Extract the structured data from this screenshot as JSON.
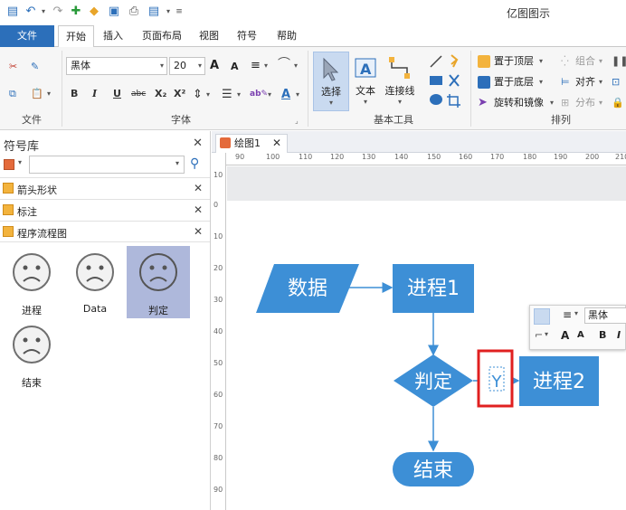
{
  "app": {
    "title": "亿图图示"
  },
  "tabs": [
    "文件",
    "开始",
    "插入",
    "页面布局",
    "视图",
    "符号",
    "帮助"
  ],
  "active_tab": "开始",
  "ribbon": {
    "font_group_label": "字体",
    "file_group_label": "文件",
    "basic_tools_label": "基本工具",
    "arrange_label": "排列",
    "font_name": "黑体",
    "font_size": "20",
    "select_label": "选择",
    "text_label": "文本",
    "connector_label": "连接线",
    "bring_front": "置于顶层",
    "send_back": "置于底层",
    "rotate_mirror": "旋转和镜像",
    "group": "组合",
    "align": "对齐",
    "distribute": "分布",
    "fmt_bold": "B",
    "fmt_italic": "I",
    "fmt_underline": "U",
    "fmt_strike": "abc",
    "fmt_sub": "X₂",
    "fmt_sup": "X²",
    "font_grow": "A",
    "font_shrink": "A",
    "font_color": "A"
  },
  "library": {
    "title": "符号库",
    "search_placeholder": "",
    "categories": [
      "箭头形状",
      "标注",
      "程序流程图"
    ],
    "symbols": [
      {
        "label": "进程",
        "selected": false
      },
      {
        "label": "Data",
        "selected": false
      },
      {
        "label": "判定",
        "selected": true
      },
      {
        "label": "结束",
        "selected": false
      }
    ]
  },
  "document": {
    "tab_name": "绘图1",
    "ruler_h": [
      "90",
      "100",
      "110",
      "120",
      "130",
      "140",
      "150",
      "160",
      "170",
      "180",
      "190",
      "200",
      "210"
    ],
    "ruler_v": [
      "10",
      "0",
      "10",
      "20",
      "30",
      "40",
      "50",
      "60",
      "70",
      "80",
      "90"
    ]
  },
  "flowchart": {
    "data_label": "数据",
    "process1_label": "进程1",
    "decision_label": "判定",
    "process2_label": "进程2",
    "end_label": "结束",
    "edit_text": "Y"
  },
  "floatbar": {
    "font": "黑体",
    "bold": "B",
    "italic": "I"
  },
  "colors": {
    "shape_fill": "#3d8fd6",
    "accent": "#2c6fba",
    "highlight": "#e02020"
  }
}
